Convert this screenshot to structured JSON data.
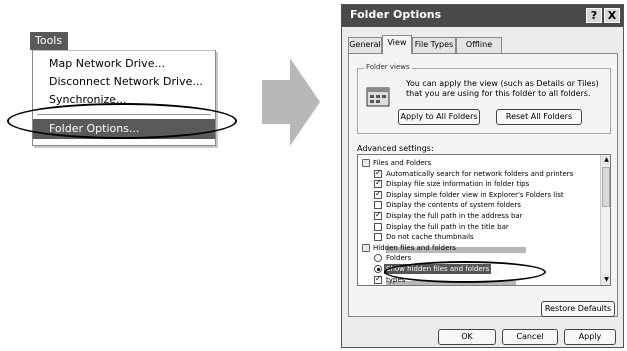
{
  "tools_menu": {
    "title": "Tools",
    "items": [
      "Map Network Drive...",
      "Disconnect Network Drive...",
      "Synchronize...",
      "Folder Options..."
    ]
  },
  "dialog": {
    "title": "Folder Options",
    "help_label": "?",
    "close_label": "X",
    "tabs": [
      "General",
      "View",
      "File Types",
      "Offline Files"
    ],
    "active_tab": "View",
    "folder_views": {
      "label": "Folder views",
      "text": "You can apply the view (such as Details or Tiles) that you are using for this folder to all folders.",
      "apply_button": "Apply to All Folders",
      "reset_button": "Reset All Folders"
    },
    "advanced": {
      "label": "Advanced settings:",
      "rows": [
        {
          "kind": "folder",
          "text": "Files and Folders"
        },
        {
          "kind": "checkbox",
          "checked": true,
          "text": "Automatically search for network folders and printers"
        },
        {
          "kind": "checkbox",
          "checked": true,
          "text": "Display file size information in folder tips"
        },
        {
          "kind": "checkbox",
          "checked": true,
          "text": "Display simple folder view in Explorer's Folders list"
        },
        {
          "kind": "checkbox",
          "checked": false,
          "text": "Display the contents of system folders"
        },
        {
          "kind": "checkbox",
          "checked": true,
          "text": "Display the full path in the address bar"
        },
        {
          "kind": "checkbox",
          "checked": false,
          "text": "Display the full path in the title bar"
        },
        {
          "kind": "checkbox",
          "checked": false,
          "text": "Do not cache thumbnails"
        },
        {
          "kind": "folder",
          "text": "Hidden files and folders"
        },
        {
          "kind": "radio",
          "checked": false,
          "text": "Folders"
        },
        {
          "kind": "radio",
          "checked": true,
          "text": "Show hidden files and folders",
          "selected": true
        },
        {
          "kind": "checkbox",
          "checked": true,
          "text": "types"
        }
      ]
    },
    "restore_button": "Restore Defaults",
    "ok_button": "OK",
    "cancel_button": "Cancel",
    "apply_button": "Apply"
  },
  "colors": {
    "menu_highlight": "#5a5a5a",
    "titlebar": "#4a4a4a",
    "arrow": "#b8b8b8"
  }
}
